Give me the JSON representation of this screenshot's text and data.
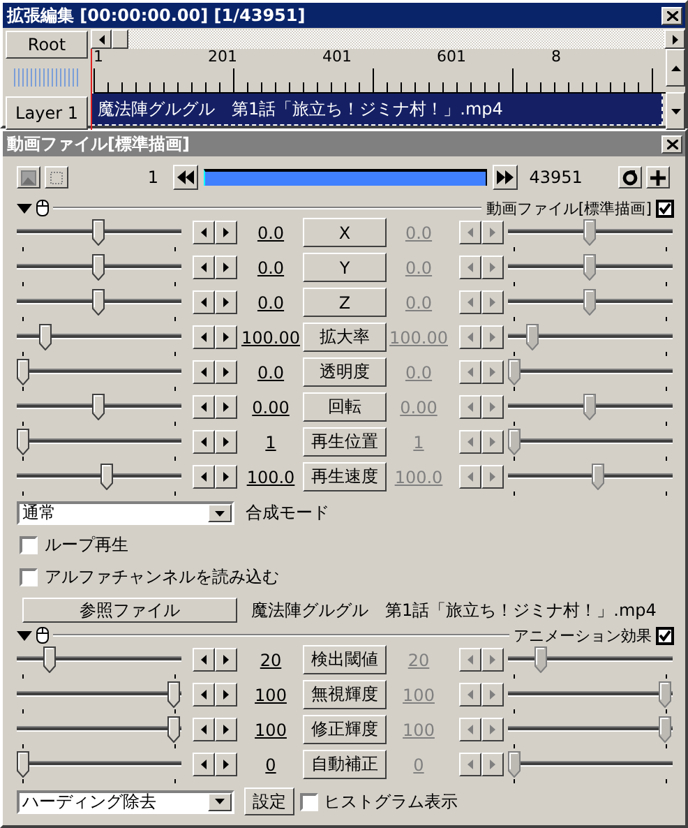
{
  "editor": {
    "title": "拡張編集 [00:00:00.00] [1/43951]",
    "root_button": "Root",
    "ruler_labels": [
      "1",
      "201",
      "401",
      "601",
      "8"
    ],
    "layer_button": "Layer 1",
    "clip": {
      "name": "魔法陣グルグル　第1話「旅立ち！ジミナ村！」.mp4",
      "selected": true
    }
  },
  "panel": {
    "title": "動画ファイル[標準描画]",
    "frame_start": "1",
    "frame_end": "43951",
    "sections": [
      {
        "title": "動画ファイル[標準描画]",
        "enabled": true,
        "params": [
          {
            "name": "X",
            "start": {
              "value": "0.0",
              "level": 0.5
            },
            "end": {
              "value": "0.0",
              "level": 0.5
            }
          },
          {
            "name": "Y",
            "start": {
              "value": "0.0",
              "level": 0.5
            },
            "end": {
              "value": "0.0",
              "level": 0.5
            }
          },
          {
            "name": "Z",
            "start": {
              "value": "0.0",
              "level": 0.5
            },
            "end": {
              "value": "0.0",
              "level": 0.5
            }
          },
          {
            "name": "拡大率",
            "start": {
              "value": "100.00",
              "level": 0.15
            },
            "end": {
              "value": "100.00",
              "level": 0.12
            }
          },
          {
            "name": "透明度",
            "start": {
              "value": "0.0",
              "level": 0
            },
            "end": {
              "value": "0.0",
              "level": 0
            }
          },
          {
            "name": "回転",
            "start": {
              "value": "0.00",
              "level": 0.5
            },
            "end": {
              "value": "0.00",
              "level": 0.5
            }
          },
          {
            "name": "再生位置",
            "start": {
              "value": "1",
              "level": 0
            },
            "end": {
              "value": "1",
              "level": 0
            }
          },
          {
            "name": "再生速度",
            "start": {
              "value": "100.0",
              "level": 0.56
            },
            "end": {
              "value": "100.0",
              "level": 0.56
            }
          }
        ],
        "options": [
          {
            "kind": "dropdown",
            "label": "合成モード",
            "selection": "通常"
          },
          {
            "kind": "checkbox",
            "label": "ループ再生",
            "checked": false
          },
          {
            "kind": "checkbox",
            "label": "アルファチャンネルを読み込む",
            "checked": false
          },
          {
            "kind": "file",
            "button": "参照ファイル",
            "file_name": "魔法陣グルグル　第1話「旅立ち！ジミナ村！」.mp4"
          }
        ]
      },
      {
        "title": "アニメーション効果",
        "enabled": true,
        "params": [
          {
            "name": "検出閾値",
            "start": {
              "value": "20",
              "level": 0.18
            },
            "end": {
              "value": "20",
              "level": 0.18
            }
          },
          {
            "name": "無視輝度",
            "start": {
              "value": "100",
              "level": 1
            },
            "end": {
              "value": "100",
              "level": 1
            }
          },
          {
            "name": "修正輝度",
            "start": {
              "value": "100",
              "level": 1
            },
            "end": {
              "value": "100",
              "level": 1
            }
          },
          {
            "name": "自動補正",
            "start": {
              "value": "0",
              "level": 0
            },
            "end": {
              "value": "0",
              "level": 0
            }
          }
        ],
        "options": [
          {
            "kind": "filter",
            "selection": "ハーディング除去",
            "button": "設定",
            "checkbox": {
              "label": "ヒストグラム表示",
              "checked": false
            }
          }
        ]
      }
    ]
  }
}
